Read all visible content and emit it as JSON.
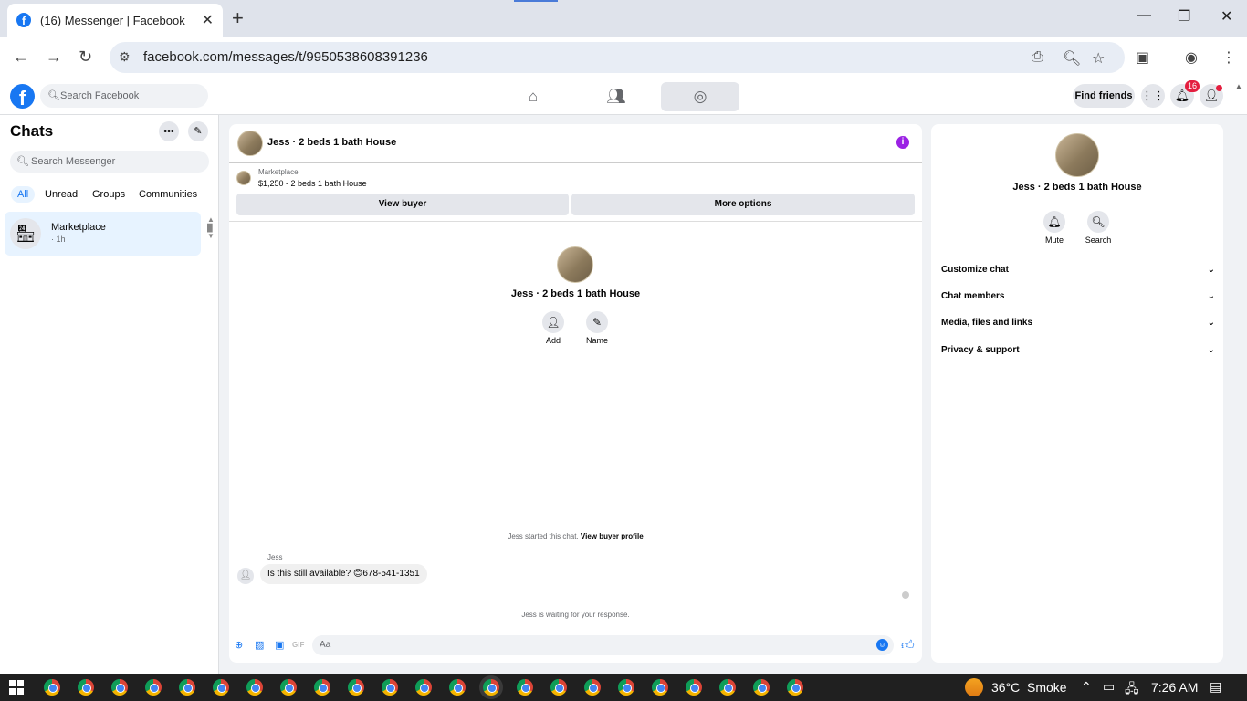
{
  "browser": {
    "tab_title": "(16) Messenger | Facebook",
    "url": "facebook.com/messages/t/9950538608391236"
  },
  "fb_header": {
    "search_placeholder": "Search Facebook",
    "find_friends": "Find friends",
    "notif_count": "16"
  },
  "left": {
    "title": "Chats",
    "search_placeholder": "Search Messenger",
    "filters": [
      "All",
      "Unread",
      "Groups",
      "Communities"
    ],
    "chat": {
      "name": "Marketplace",
      "time": "· 1h"
    }
  },
  "conversation": {
    "title": "Jess · 2 beds 1 bath House",
    "mp_label": "Marketplace",
    "mp_price": "$1,250 - 2 beds 1 bath House",
    "view_buyer": "View buyer",
    "more_options": "More options",
    "center_title": "Jess · 2 beds 1 bath House",
    "add_label": "Add",
    "name_label": "Name",
    "started_text": "Jess started this chat.",
    "started_link": "View buyer profile",
    "sender": "Jess",
    "message": "Is this still available? 😊678-541-1351",
    "waiting": "Jess is waiting for your response.",
    "composer_placeholder": "Aa"
  },
  "right": {
    "title": "Jess · 2 beds 1 bath House",
    "mute_label": "Mute",
    "search_label": "Search",
    "sections": [
      "Customize chat",
      "Chat members",
      "Media, files and links",
      "Privacy & support"
    ]
  },
  "taskbar": {
    "temperature": "36°C",
    "weather": "Smoke",
    "time": "7:26 AM"
  },
  "colors": {
    "fb_blue": "#1877f2",
    "badge_red": "#e41e3f",
    "info_purple": "#9b22e4"
  }
}
